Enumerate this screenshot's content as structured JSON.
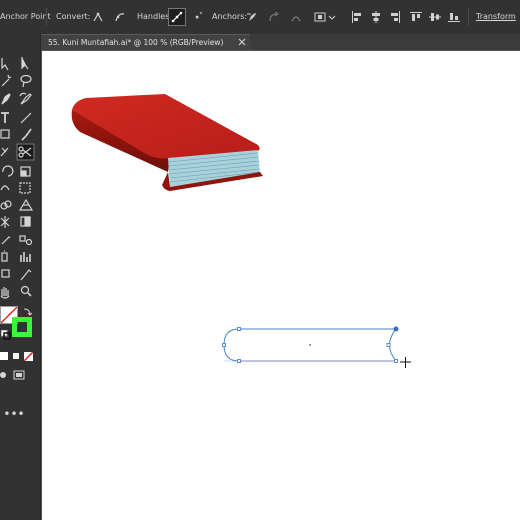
{
  "control_bar": {
    "tool_name": "Anchor Point",
    "convert_label": "Convert:",
    "handles_label": "Handles:",
    "anchors_label": "Anchors:",
    "transform_label": "Transform"
  },
  "document_tab": {
    "title": "55. Kuni Muntafiah.ai* @ 100 % (RGB/Preview)",
    "close_icon": "close-icon"
  },
  "tools_panel": {
    "icons": [
      "selection-tool-icon",
      "direct-selection-tool-icon",
      "magic-wand-icon",
      "lasso-icon",
      "pen-icon",
      "curvature-icon",
      "type-icon",
      "line-segment-icon",
      "rectangle-icon",
      "paintbrush-icon",
      "shaper-icon",
      "scissors-icon",
      "rotate-icon",
      "scale-icon",
      "width-icon",
      "free-transform-icon",
      "shape-builder-icon",
      "perspective-grid-icon",
      "mesh-icon",
      "gradient-icon",
      "eyedropper-icon",
      "blend-icon",
      "symbol-sprayer-icon",
      "column-graph-icon",
      "artboard-icon",
      "slice-icon",
      "hand-icon",
      "zoom-icon",
      "fill-swatch",
      "stroke-swatch",
      "swap-fill-stroke-icon",
      "default-fill-stroke-icon",
      "color-mode-icon",
      "gradient-mode-icon",
      "none-mode-icon",
      "drawing-mode-icon",
      "screen-mode-icon",
      "edit-toolbar-icon"
    ],
    "stroke_color": "#3df53d",
    "fill_color": "none"
  },
  "colors": {
    "book_cover": "#c2231d",
    "book_pages": "#a6d2dc",
    "path_stroke": "#4a86c8",
    "selected_anchor": "#3a6fbd"
  }
}
